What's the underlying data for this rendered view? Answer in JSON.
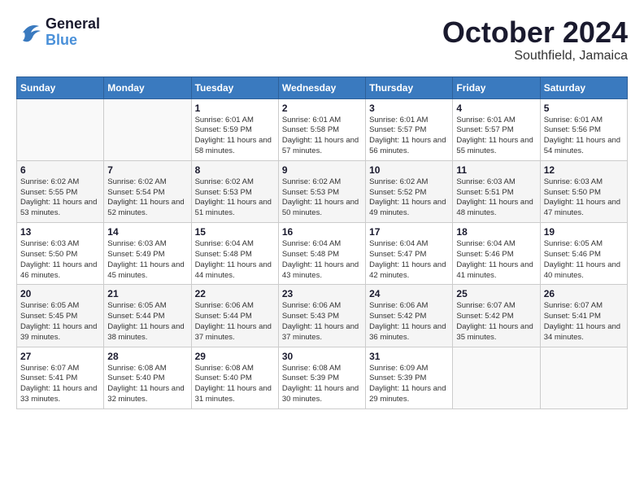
{
  "logo": {
    "text1": "General",
    "text2": "Blue"
  },
  "title": {
    "month": "October 2024",
    "location": "Southfield, Jamaica"
  },
  "headers": [
    "Sunday",
    "Monday",
    "Tuesday",
    "Wednesday",
    "Thursday",
    "Friday",
    "Saturday"
  ],
  "weeks": [
    [
      {
        "day": "",
        "info": ""
      },
      {
        "day": "",
        "info": ""
      },
      {
        "day": "1",
        "info": "Sunrise: 6:01 AM\nSunset: 5:59 PM\nDaylight: 11 hours and 58 minutes."
      },
      {
        "day": "2",
        "info": "Sunrise: 6:01 AM\nSunset: 5:58 PM\nDaylight: 11 hours and 57 minutes."
      },
      {
        "day": "3",
        "info": "Sunrise: 6:01 AM\nSunset: 5:57 PM\nDaylight: 11 hours and 56 minutes."
      },
      {
        "day": "4",
        "info": "Sunrise: 6:01 AM\nSunset: 5:57 PM\nDaylight: 11 hours and 55 minutes."
      },
      {
        "day": "5",
        "info": "Sunrise: 6:01 AM\nSunset: 5:56 PM\nDaylight: 11 hours and 54 minutes."
      }
    ],
    [
      {
        "day": "6",
        "info": "Sunrise: 6:02 AM\nSunset: 5:55 PM\nDaylight: 11 hours and 53 minutes."
      },
      {
        "day": "7",
        "info": "Sunrise: 6:02 AM\nSunset: 5:54 PM\nDaylight: 11 hours and 52 minutes."
      },
      {
        "day": "8",
        "info": "Sunrise: 6:02 AM\nSunset: 5:53 PM\nDaylight: 11 hours and 51 minutes."
      },
      {
        "day": "9",
        "info": "Sunrise: 6:02 AM\nSunset: 5:53 PM\nDaylight: 11 hours and 50 minutes."
      },
      {
        "day": "10",
        "info": "Sunrise: 6:02 AM\nSunset: 5:52 PM\nDaylight: 11 hours and 49 minutes."
      },
      {
        "day": "11",
        "info": "Sunrise: 6:03 AM\nSunset: 5:51 PM\nDaylight: 11 hours and 48 minutes."
      },
      {
        "day": "12",
        "info": "Sunrise: 6:03 AM\nSunset: 5:50 PM\nDaylight: 11 hours and 47 minutes."
      }
    ],
    [
      {
        "day": "13",
        "info": "Sunrise: 6:03 AM\nSunset: 5:50 PM\nDaylight: 11 hours and 46 minutes."
      },
      {
        "day": "14",
        "info": "Sunrise: 6:03 AM\nSunset: 5:49 PM\nDaylight: 11 hours and 45 minutes."
      },
      {
        "day": "15",
        "info": "Sunrise: 6:04 AM\nSunset: 5:48 PM\nDaylight: 11 hours and 44 minutes."
      },
      {
        "day": "16",
        "info": "Sunrise: 6:04 AM\nSunset: 5:48 PM\nDaylight: 11 hours and 43 minutes."
      },
      {
        "day": "17",
        "info": "Sunrise: 6:04 AM\nSunset: 5:47 PM\nDaylight: 11 hours and 42 minutes."
      },
      {
        "day": "18",
        "info": "Sunrise: 6:04 AM\nSunset: 5:46 PM\nDaylight: 11 hours and 41 minutes."
      },
      {
        "day": "19",
        "info": "Sunrise: 6:05 AM\nSunset: 5:46 PM\nDaylight: 11 hours and 40 minutes."
      }
    ],
    [
      {
        "day": "20",
        "info": "Sunrise: 6:05 AM\nSunset: 5:45 PM\nDaylight: 11 hours and 39 minutes."
      },
      {
        "day": "21",
        "info": "Sunrise: 6:05 AM\nSunset: 5:44 PM\nDaylight: 11 hours and 38 minutes."
      },
      {
        "day": "22",
        "info": "Sunrise: 6:06 AM\nSunset: 5:44 PM\nDaylight: 11 hours and 37 minutes."
      },
      {
        "day": "23",
        "info": "Sunrise: 6:06 AM\nSunset: 5:43 PM\nDaylight: 11 hours and 37 minutes."
      },
      {
        "day": "24",
        "info": "Sunrise: 6:06 AM\nSunset: 5:42 PM\nDaylight: 11 hours and 36 minutes."
      },
      {
        "day": "25",
        "info": "Sunrise: 6:07 AM\nSunset: 5:42 PM\nDaylight: 11 hours and 35 minutes."
      },
      {
        "day": "26",
        "info": "Sunrise: 6:07 AM\nSunset: 5:41 PM\nDaylight: 11 hours and 34 minutes."
      }
    ],
    [
      {
        "day": "27",
        "info": "Sunrise: 6:07 AM\nSunset: 5:41 PM\nDaylight: 11 hours and 33 minutes."
      },
      {
        "day": "28",
        "info": "Sunrise: 6:08 AM\nSunset: 5:40 PM\nDaylight: 11 hours and 32 minutes."
      },
      {
        "day": "29",
        "info": "Sunrise: 6:08 AM\nSunset: 5:40 PM\nDaylight: 11 hours and 31 minutes."
      },
      {
        "day": "30",
        "info": "Sunrise: 6:08 AM\nSunset: 5:39 PM\nDaylight: 11 hours and 30 minutes."
      },
      {
        "day": "31",
        "info": "Sunrise: 6:09 AM\nSunset: 5:39 PM\nDaylight: 11 hours and 29 minutes."
      },
      {
        "day": "",
        "info": ""
      },
      {
        "day": "",
        "info": ""
      }
    ]
  ]
}
